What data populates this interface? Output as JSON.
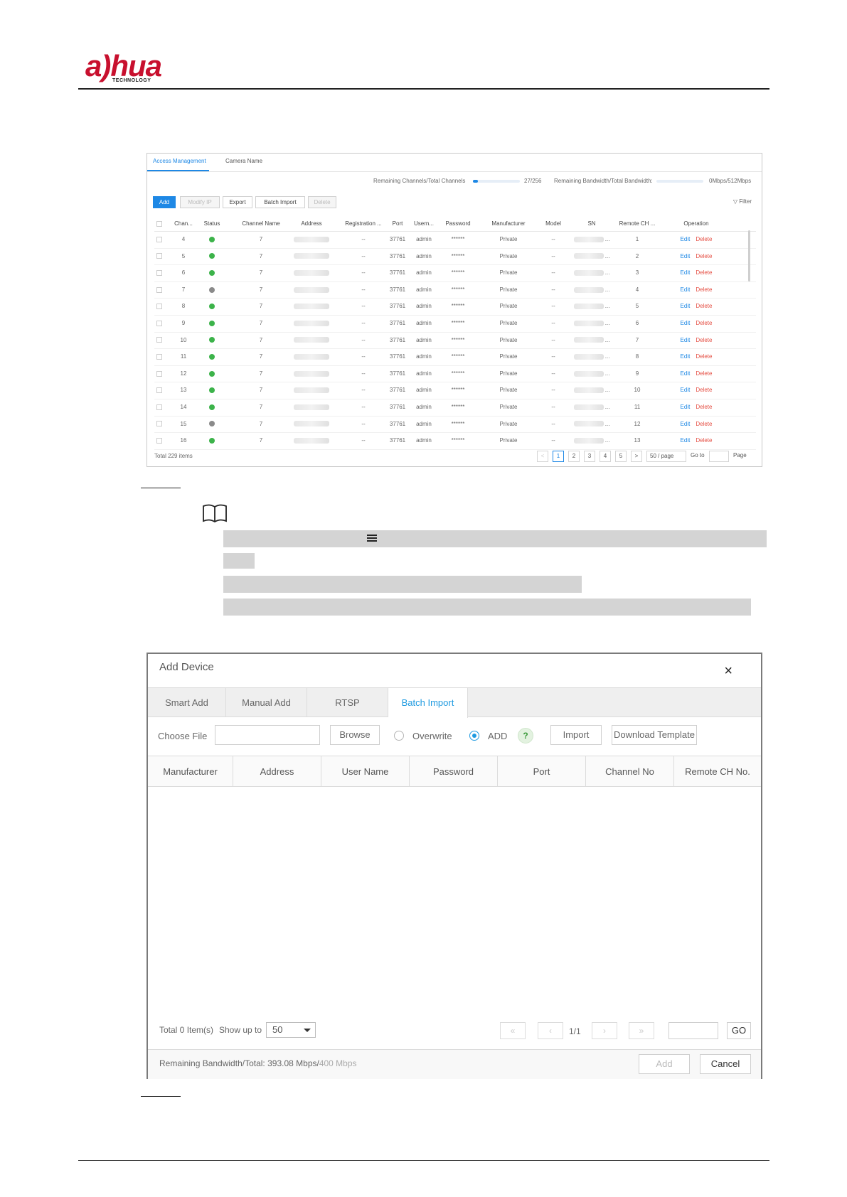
{
  "header": {
    "logo_text": "a)hua",
    "logo_sub": "TECHNOLOGY"
  },
  "shot1": {
    "tabs": [
      "Access Management",
      "Camera Name"
    ],
    "stats": {
      "channels_label": "Remaining Channels/Total Channels",
      "channels_value": "27/256",
      "channels_fraction": 0.1,
      "bandwidth_label": "Remaining Bandwidth/Total Bandwidth:",
      "bandwidth_value": "0Mbps/512Mbps",
      "bandwidth_fraction": 0
    },
    "toolbar": {
      "add": "Add",
      "modify_ip": "Modify IP",
      "export": "Export",
      "batch_import": "Batch Import",
      "delete": "Delete",
      "filter": "Filter"
    },
    "columns": [
      "Chan...",
      "Status",
      "Channel Name",
      "Address",
      "Registration ...",
      "Port",
      "Usern...",
      "Password",
      "Manufacturer",
      "Model",
      "SN",
      "Remote CH ...",
      "Operation"
    ],
    "rows": [
      {
        "ch": "4",
        "status": "ok",
        "name": "7",
        "reg": "--",
        "port": "37761",
        "user": "admin",
        "pwd": "******",
        "mfr": "Private",
        "model": "--",
        "remote": "1"
      },
      {
        "ch": "5",
        "status": "ok",
        "name": "7",
        "reg": "--",
        "port": "37761",
        "user": "admin",
        "pwd": "******",
        "mfr": "Private",
        "model": "--",
        "remote": "2"
      },
      {
        "ch": "6",
        "status": "ok",
        "name": "7",
        "reg": "--",
        "port": "37761",
        "user": "admin",
        "pwd": "******",
        "mfr": "Private",
        "model": "--",
        "remote": "3"
      },
      {
        "ch": "7",
        "status": "off",
        "name": "7",
        "reg": "--",
        "port": "37761",
        "user": "admin",
        "pwd": "******",
        "mfr": "Private",
        "model": "--",
        "remote": "4"
      },
      {
        "ch": "8",
        "status": "ok",
        "name": "7",
        "reg": "--",
        "port": "37761",
        "user": "admin",
        "pwd": "******",
        "mfr": "Private",
        "model": "--",
        "remote": "5"
      },
      {
        "ch": "9",
        "status": "ok",
        "name": "7",
        "reg": "--",
        "port": "37761",
        "user": "admin",
        "pwd": "******",
        "mfr": "Private",
        "model": "--",
        "remote": "6"
      },
      {
        "ch": "10",
        "status": "ok",
        "name": "7",
        "reg": "--",
        "port": "37761",
        "user": "admin",
        "pwd": "******",
        "mfr": "Private",
        "model": "--",
        "remote": "7"
      },
      {
        "ch": "11",
        "status": "ok",
        "name": "7",
        "reg": "--",
        "port": "37761",
        "user": "admin",
        "pwd": "******",
        "mfr": "Private",
        "model": "--",
        "remote": "8"
      },
      {
        "ch": "12",
        "status": "ok",
        "name": "7",
        "reg": "--",
        "port": "37761",
        "user": "admin",
        "pwd": "******",
        "mfr": "Private",
        "model": "--",
        "remote": "9"
      },
      {
        "ch": "13",
        "status": "ok",
        "name": "7",
        "reg": "--",
        "port": "37761",
        "user": "admin",
        "pwd": "******",
        "mfr": "Private",
        "model": "--",
        "remote": "10"
      },
      {
        "ch": "14",
        "status": "ok",
        "name": "7",
        "reg": "--",
        "port": "37761",
        "user": "admin",
        "pwd": "******",
        "mfr": "Private",
        "model": "--",
        "remote": "11"
      },
      {
        "ch": "15",
        "status": "off",
        "name": "7",
        "reg": "--",
        "port": "37761",
        "user": "admin",
        "pwd": "******",
        "mfr": "Private",
        "model": "--",
        "remote": "12"
      },
      {
        "ch": "16",
        "status": "ok",
        "name": "7",
        "reg": "--",
        "port": "37761",
        "user": "admin",
        "pwd": "******",
        "mfr": "Private",
        "model": "--",
        "remote": "13"
      }
    ],
    "op_edit": "Edit",
    "op_delete": "Delete",
    "total": "Total 229 items",
    "pager": {
      "prev": "<",
      "pages": [
        "1",
        "2",
        "3",
        "4",
        "5"
      ],
      "next": ">",
      "page_size": "50 / page",
      "goto": "Go to",
      "page": "Page"
    }
  },
  "dialog": {
    "title": "Add Device",
    "close": "×",
    "tabs": [
      "Smart Add",
      "Manual Add",
      "RTSP",
      "Batch Import"
    ],
    "active_tab": "Batch Import",
    "choose_file": "Choose File",
    "browse": "Browse",
    "overwrite": "Overwrite",
    "add_mode": "ADD",
    "help": "?",
    "import": "Import",
    "download_template": "Download Template",
    "columns": [
      "Manufacturer",
      "Address",
      "User Name",
      "Password",
      "Port",
      "Channel No",
      "Remote CH No."
    ],
    "total": "Total 0 Item(s)",
    "show_up_to": "Show up to",
    "show_value": "50",
    "page_info": "1/1",
    "first": "«",
    "prev": "‹",
    "next": "›",
    "last": "»",
    "go": "GO",
    "bandwidth_label": "Remaining Bandwidth/Total:",
    "bandwidth_remaining": "393.08 Mbps/",
    "bandwidth_total": "400 Mbps",
    "add_button": "Add",
    "cancel_button": "Cancel"
  }
}
